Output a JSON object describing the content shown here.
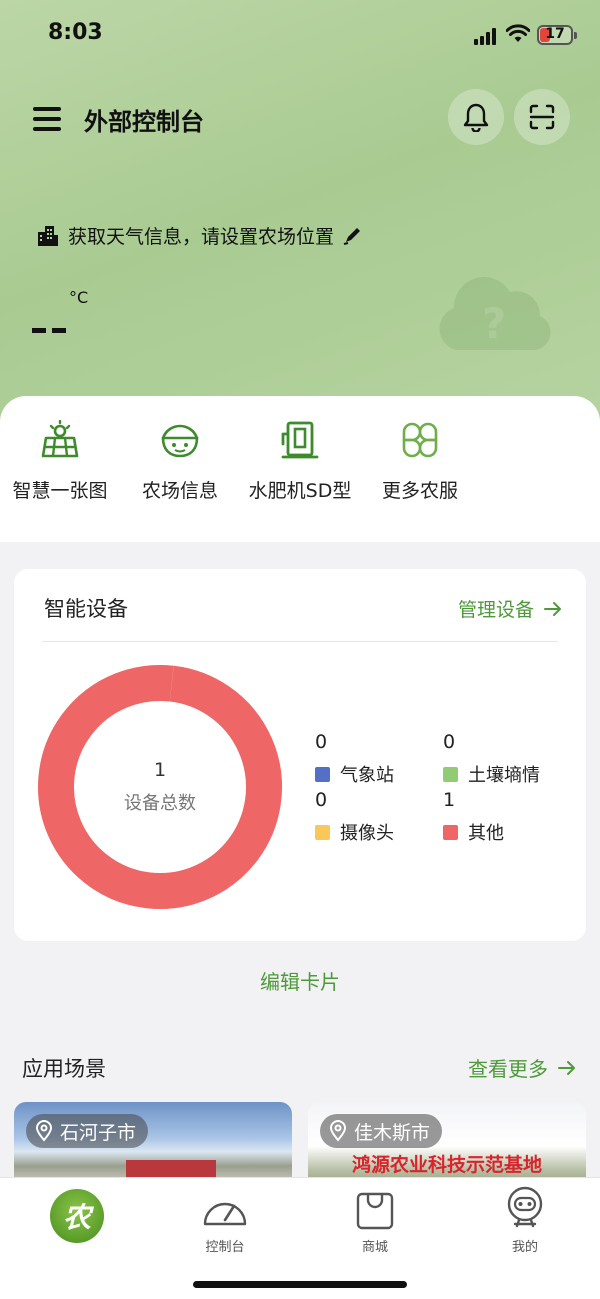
{
  "status_bar": {
    "time": "8:03",
    "battery": "17"
  },
  "header": {
    "title": "外部控制台"
  },
  "weather": {
    "message": "获取天气信息，请设置农场位置",
    "temp_unit": "°C",
    "temp_placeholder": "--"
  },
  "services": [
    {
      "label": "智慧一张图",
      "icon": "smart-map-icon"
    },
    {
      "label": "农场信息",
      "icon": "farm-info-icon"
    },
    {
      "label": "水肥机SD型",
      "icon": "fertigation-icon"
    },
    {
      "label": "更多农服",
      "icon": "more-services-icon"
    }
  ],
  "devices": {
    "title": "智能设备",
    "manage_label": "管理设备",
    "total": "1",
    "total_label": "设备总数",
    "legend": [
      {
        "name": "气象站",
        "count": "0",
        "color": "#5470c6"
      },
      {
        "name": "土壤墒情",
        "count": "0",
        "color": "#91cc75"
      },
      {
        "name": "摄像头",
        "count": "0",
        "color": "#fac858"
      },
      {
        "name": "其他",
        "count": "1",
        "color": "#ee6666"
      }
    ]
  },
  "chart_data": {
    "type": "pie",
    "categories": [
      "气象站",
      "土壤墒情",
      "摄像头",
      "其他"
    ],
    "values": [
      0,
      0,
      0,
      1
    ],
    "center_value": "1",
    "center_label": "设备总数"
  },
  "edit_card_label": "编辑卡片",
  "scenes": {
    "title": "应用场景",
    "more_label": "查看更多",
    "items": [
      {
        "location": "石河子市"
      },
      {
        "location": "佳木斯市",
        "banner": "鸿源农业科技示范基地"
      }
    ]
  },
  "tabbar": {
    "home_badge": "农",
    "items": [
      {
        "label": "控制台"
      },
      {
        "label": "商城"
      },
      {
        "label": "我的"
      }
    ]
  }
}
